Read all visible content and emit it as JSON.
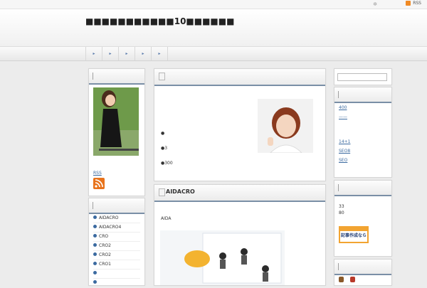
{
  "header": {
    "site_title": "■■■■■■■■■■■10■■■■■■"
  },
  "topbar": {
    "rss_label": "RSS"
  },
  "nav": {
    "items": [
      "▸",
      "▸",
      "▸",
      "▸",
      "▸"
    ]
  },
  "left_sidebar": {
    "profile": {
      "title": "",
      "rss_label": "RSS"
    },
    "categories": {
      "title": "",
      "items": [
        "AIDACRO",
        "AIDACRO4",
        "CRO",
        "CRO2",
        "CRO2",
        "CRO1",
        "",
        ""
      ]
    }
  },
  "main": {
    "post1": {
      "title": "",
      "lines": [
        "●",
        "●3",
        "●300"
      ]
    },
    "post2": {
      "title": "AIDACRO",
      "intro": "AIDA"
    }
  },
  "right_sidebar": {
    "search": {
      "placeholder": ""
    },
    "recent": {
      "title": "",
      "items": [
        "400",
        "——",
        "14+1",
        "SEO8",
        "SEO"
      ]
    },
    "stats": {
      "title": "",
      "lines": [
        "33",
        "80"
      ],
      "banner_text": "記事作成なら"
    },
    "bottom": {
      "title": ""
    }
  }
}
